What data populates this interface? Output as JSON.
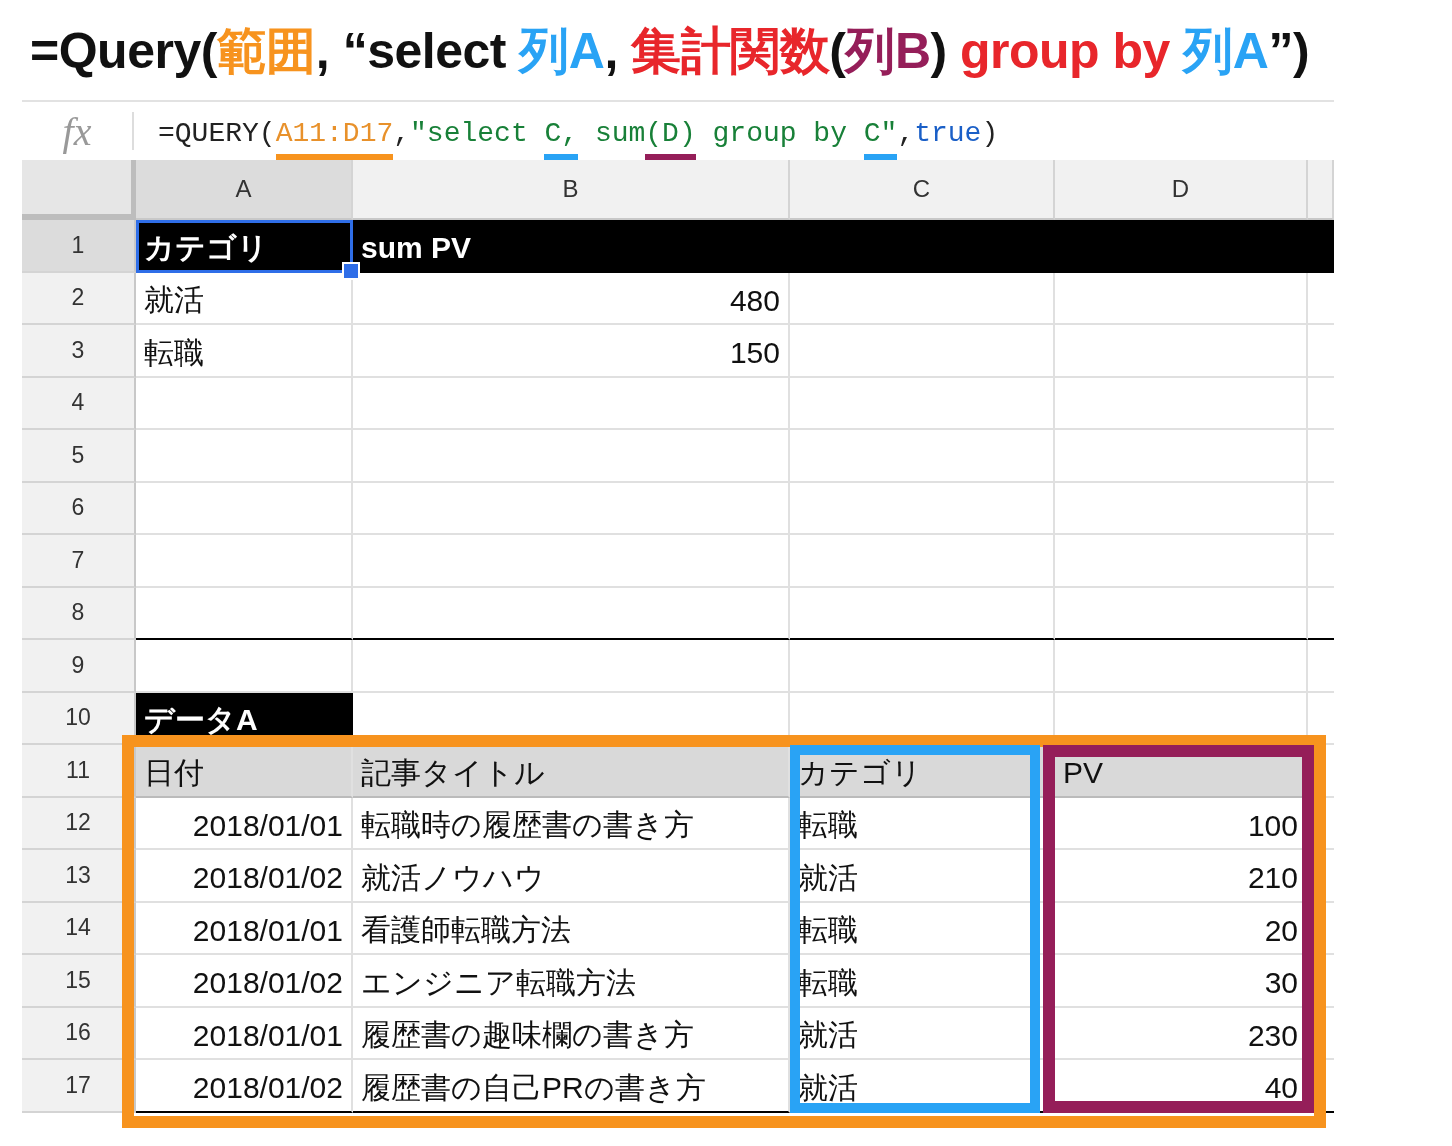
{
  "title": [
    {
      "text": "=Query(",
      "color": "#111111"
    },
    {
      "text": "範囲",
      "color": "#f7931e"
    },
    {
      "text": ", “select ",
      "color": "#111111"
    },
    {
      "text": "列A",
      "color": "#29a3f5"
    },
    {
      "text": ", ",
      "color": "#111111"
    },
    {
      "text": "集計関数",
      "color": "#e8262b"
    },
    {
      "text": "(",
      "color": "#111111"
    },
    {
      "text": "列B",
      "color": "#951e59"
    },
    {
      "text": ") ",
      "color": "#111111"
    },
    {
      "text": "group by ",
      "color": "#e8262b"
    },
    {
      "text": "列A",
      "color": "#29a3f5"
    },
    {
      "text": "”)",
      "color": "#111111"
    }
  ],
  "formula_bar": {
    "icon_label": "fx",
    "segments": [
      {
        "text": "=QUERY(",
        "color": "#222222"
      },
      {
        "text": "A11:D17",
        "color": "#e8912b",
        "underline": {
          "color": "#f7931e"
        }
      },
      {
        "text": ",",
        "color": "#222222"
      },
      {
        "text": "\"select ",
        "color": "#188038"
      },
      {
        "text": "C,",
        "color": "#188038",
        "underline": {
          "color": "#29a3f5"
        }
      },
      {
        "text": " sum",
        "color": "#188038"
      },
      {
        "text": "(D)",
        "color": "#188038",
        "underline": {
          "color": "#951e59"
        }
      },
      {
        "text": " group by ",
        "color": "#188038"
      },
      {
        "text": "C\"",
        "color": "#188038",
        "underline": {
          "color": "#29a3f5"
        }
      },
      {
        "text": ",",
        "color": "#222222"
      },
      {
        "text": "true",
        "color": "#1a5fc7"
      },
      {
        "text": ")",
        "color": "#222222"
      }
    ]
  },
  "columns": [
    "A",
    "B",
    "C",
    "D"
  ],
  "rows": [
    {
      "label": "1",
      "dark_band": true,
      "cells": [
        {
          "text": "カテゴリ",
          "kind": "text",
          "selected": true
        },
        {
          "text": "sum PV",
          "kind": "text",
          "selected": false
        }
      ]
    },
    {
      "label": "2",
      "cells": [
        {
          "text": "就活",
          "kind": "text",
          "selected": false
        },
        {
          "text": "480",
          "kind": "number",
          "selected": false
        }
      ]
    },
    {
      "label": "3",
      "cells": [
        {
          "text": "転職",
          "kind": "text",
          "selected": false
        },
        {
          "text": "150",
          "kind": "number",
          "selected": false
        }
      ]
    },
    {
      "label": "4"
    },
    {
      "label": "5"
    },
    {
      "label": "6"
    },
    {
      "label": "7"
    },
    {
      "label": "8",
      "bottom_border": true
    },
    {
      "label": "9"
    },
    {
      "label": "10",
      "cells": [
        {
          "text": "データA",
          "kind": "dark",
          "selected": false
        }
      ]
    },
    {
      "label": "11",
      "cells": [
        {
          "text": "日付",
          "kind": "gray",
          "selected": false
        },
        {
          "text": "記事タイトル",
          "kind": "gray",
          "selected": false
        },
        {
          "text": "カテゴリ",
          "kind": "gray",
          "selected": false
        },
        {
          "text": "PV",
          "kind": "gray",
          "selected": false
        }
      ]
    },
    {
      "label": "12",
      "cells": [
        {
          "text": "2018/01/01",
          "kind": "number",
          "selected": false
        },
        {
          "text": "転職時の履歴書の書き方",
          "kind": "text",
          "selected": false
        },
        {
          "text": "転職",
          "kind": "text",
          "selected": false
        },
        {
          "text": "100",
          "kind": "number",
          "selected": false
        }
      ]
    },
    {
      "label": "13",
      "cells": [
        {
          "text": "2018/01/02",
          "kind": "number",
          "selected": false
        },
        {
          "text": "就活ノウハウ",
          "kind": "text",
          "selected": false
        },
        {
          "text": "就活",
          "kind": "text",
          "selected": false
        },
        {
          "text": "210",
          "kind": "number",
          "selected": false
        }
      ]
    },
    {
      "label": "14",
      "cells": [
        {
          "text": "2018/01/01",
          "kind": "number",
          "selected": false
        },
        {
          "text": "看護師転職方法",
          "kind": "text",
          "selected": false
        },
        {
          "text": "転職",
          "kind": "text",
          "selected": false
        },
        {
          "text": "20",
          "kind": "number",
          "selected": false
        }
      ]
    },
    {
      "label": "15",
      "cells": [
        {
          "text": "2018/01/02",
          "kind": "number",
          "selected": false
        },
        {
          "text": "エンジニア転職方法",
          "kind": "text",
          "selected": false
        },
        {
          "text": "転職",
          "kind": "text",
          "selected": false
        },
        {
          "text": "30",
          "kind": "number",
          "selected": false
        }
      ]
    },
    {
      "label": "16",
      "cells": [
        {
          "text": "2018/01/01",
          "kind": "number",
          "selected": false
        },
        {
          "text": "履歴書の趣味欄の書き方",
          "kind": "text",
          "selected": false
        },
        {
          "text": "就活",
          "kind": "text",
          "selected": false
        },
        {
          "text": "230",
          "kind": "number",
          "selected": false
        }
      ]
    },
    {
      "label": "17",
      "bottom_border": true,
      "cells": [
        {
          "text": "2018/01/02",
          "kind": "number",
          "selected": false
        },
        {
          "text": "履歴書の自己PRの書き方",
          "kind": "text",
          "selected": false
        },
        {
          "text": "就活",
          "kind": "text",
          "selected": false
        },
        {
          "text": "40",
          "kind": "number",
          "selected": false
        }
      ]
    }
  ],
  "annotations": [
    {
      "kind": "whole_table",
      "color": "#f7931e"
    },
    {
      "kind": "category_column",
      "color": "#29a3f5"
    },
    {
      "kind": "value_column",
      "color": "#951e59"
    }
  ]
}
